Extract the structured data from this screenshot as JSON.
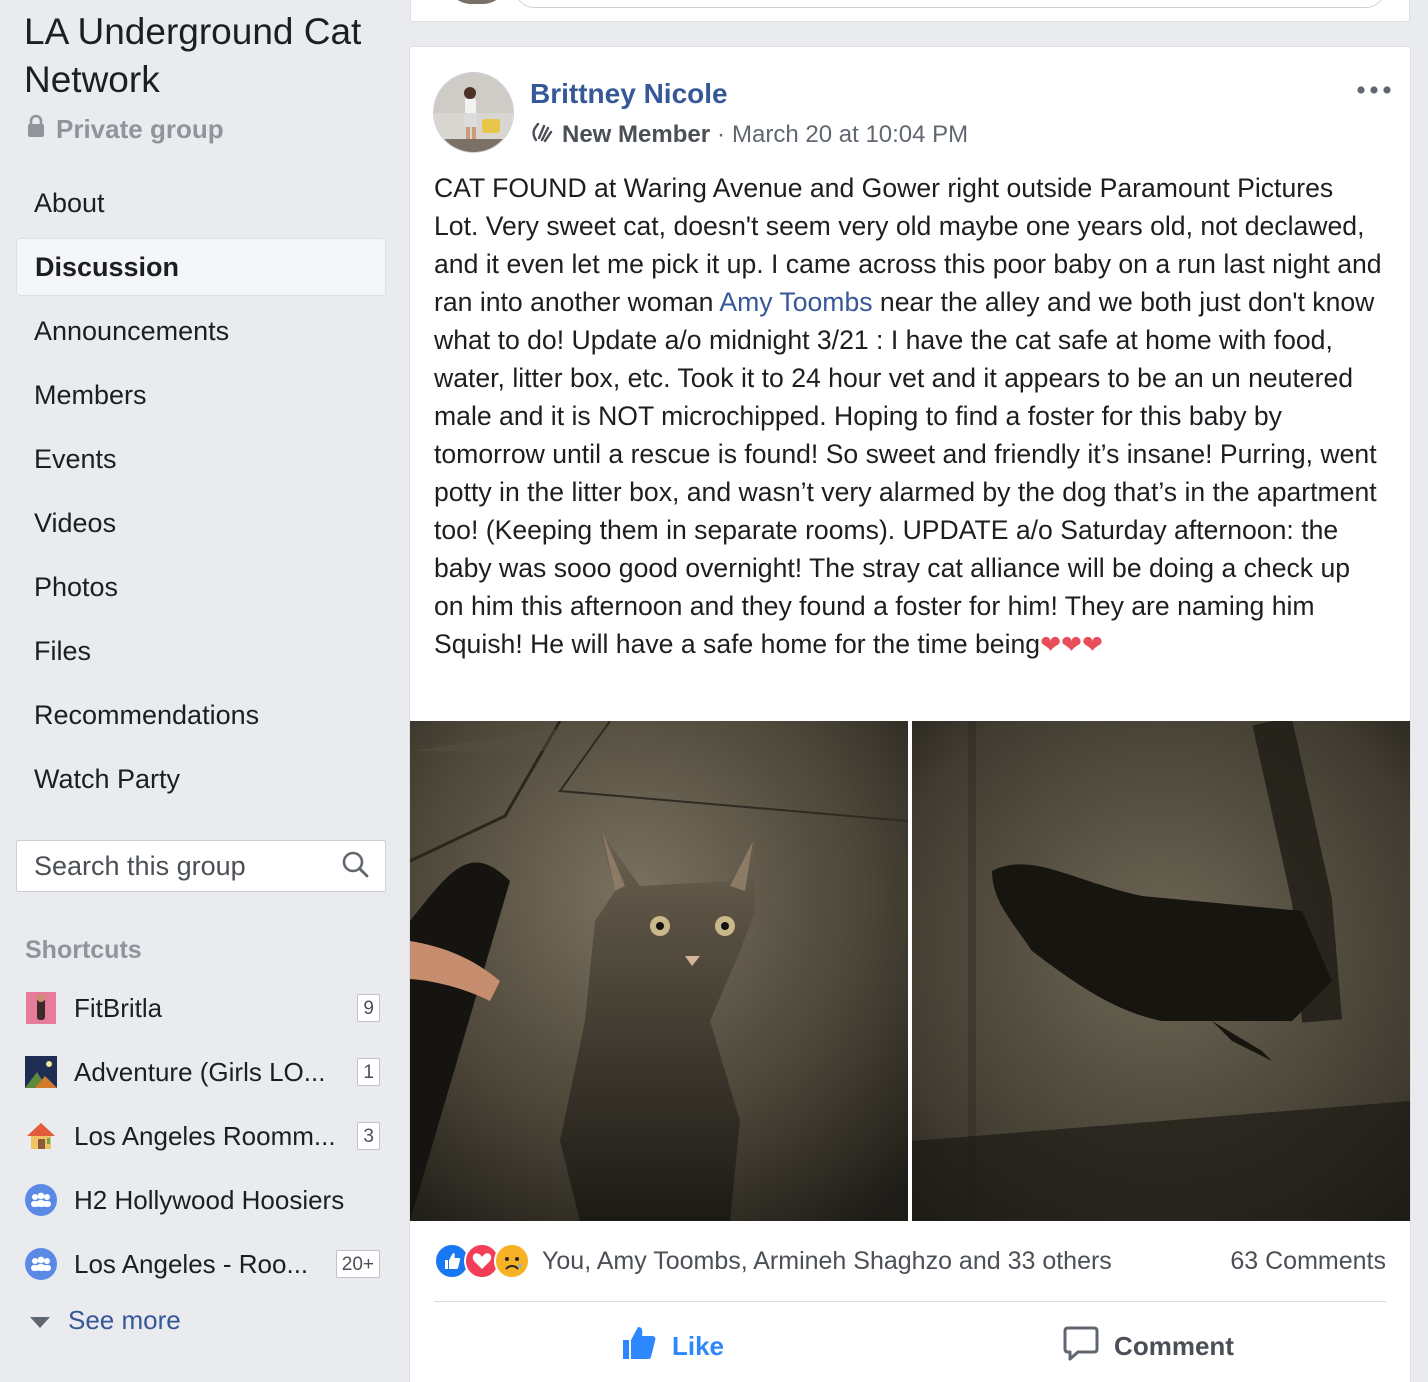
{
  "group": {
    "title": "LA Underground Cat Network",
    "privacy": "Private group"
  },
  "nav": {
    "items": [
      {
        "label": "About"
      },
      {
        "label": "Discussion",
        "active": true
      },
      {
        "label": "Announcements"
      },
      {
        "label": "Members"
      },
      {
        "label": "Events"
      },
      {
        "label": "Videos"
      },
      {
        "label": "Photos"
      },
      {
        "label": "Files"
      },
      {
        "label": "Recommendations"
      },
      {
        "label": "Watch Party"
      }
    ]
  },
  "search": {
    "placeholder": "Search this group",
    "icon": "search-icon"
  },
  "shortcuts": {
    "heading": "Shortcuts",
    "items": [
      {
        "label": "FitBritla",
        "count": "9"
      },
      {
        "label": "Adventure (Girls LO...",
        "count": "1"
      },
      {
        "label": "Los Angeles Roomm...",
        "count": "3"
      },
      {
        "label": "H2 Hollywood Hoosiers",
        "count": ""
      },
      {
        "label": "Los Angeles - Roo...",
        "count": "20+"
      }
    ],
    "see_more": "See more"
  },
  "post": {
    "author": "Brittney Nicole",
    "badge": "New Member",
    "separator": "·",
    "timestamp": "March 20 at 10:04 PM",
    "text_before_mention": "CAT FOUND at Waring Avenue and Gower right outside Paramount Pictures Lot. Very sweet cat, doesn't seem very old maybe one years old, not declawed, and it even let me pick it up. I came across this poor baby on a run last night and ran into another woman ",
    "mention": "Amy Toombs",
    "text_after_mention": " near the alley and we both just don't know what to do! Update a/o midnight 3/21 : I have the cat safe at home with food, water, litter box, etc. Took it to 24 hour vet and it appears to be an un neutered male and it is NOT microchipped. Hoping to find a foster for this baby by tomorrow until a rescue is found! So sweet and friendly it’s insane! Purring, went potty in the litter box, and wasn’t very alarmed by the dog that’s in the apartment too! (Keeping them in separate rooms). UPDATE a/o Saturday afternoon: the baby was sooo good overnight! The stray cat alliance will be doing a check up on him this afternoon and they found a foster for him! They are naming him Squish! He will have a safe home for the time being",
    "hearts": "❤❤❤",
    "reactions_text": "You, Amy Toombs, Armineh Shaghzo and 33 others",
    "comments_count": "63 Comments",
    "like_label": "Like",
    "comment_label": "Comment"
  },
  "colors": {
    "link": "#365899",
    "like_blue": "#2d88ff",
    "background": "#e9ebee"
  }
}
